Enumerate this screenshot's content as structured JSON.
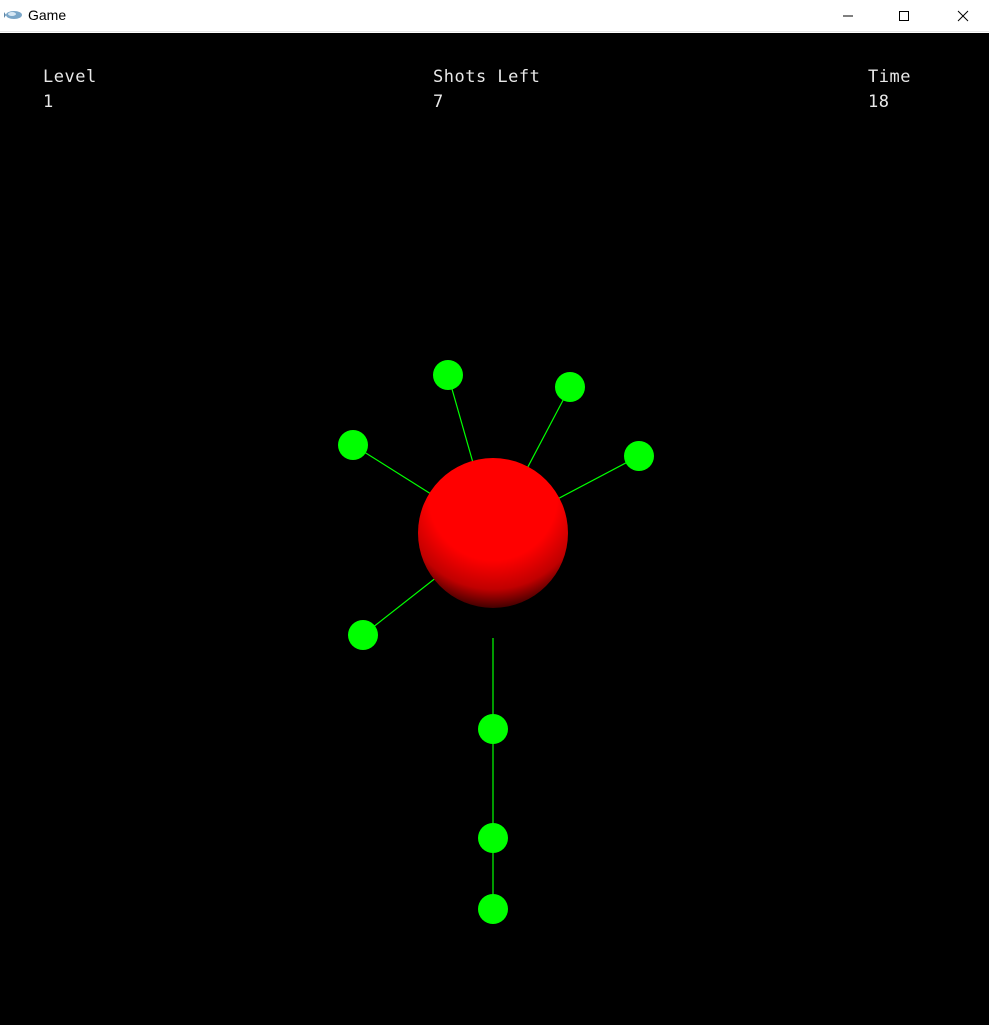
{
  "window": {
    "title": "Game",
    "app_icon": "game-app-icon",
    "controls": [
      "minimize-icon",
      "maximize-icon",
      "close-icon"
    ]
  },
  "hud": {
    "level_label": "Level",
    "level_value": "1",
    "shots_label": "Shots Left",
    "shots_value": "7",
    "time_label": "Time",
    "time_value": "18"
  },
  "game": {
    "background_color": "#000000",
    "core_color": "#ff0000",
    "pin_color": "#00ff00",
    "pins_attached_count": 6,
    "queued_shots_visible": 3
  }
}
